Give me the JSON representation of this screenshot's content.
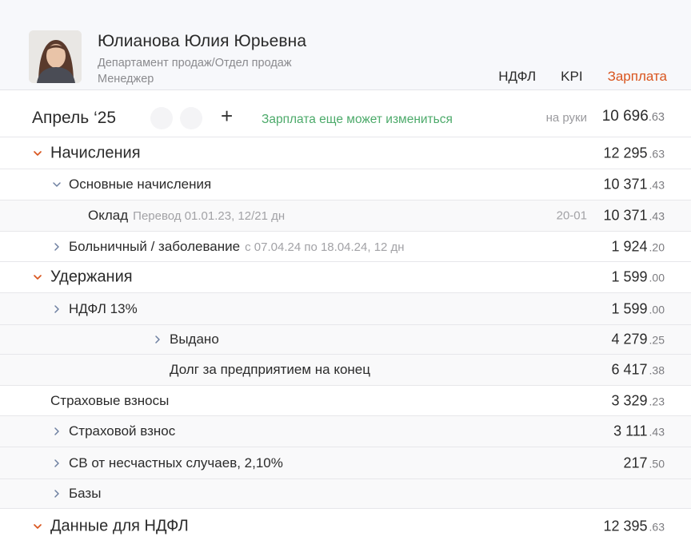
{
  "employee": {
    "name": "Юлианова Юлия Юрьевна",
    "department": "Департамент продаж/Отдел продаж",
    "role": "Менеджер"
  },
  "tabs": [
    "НДФЛ",
    "KPI",
    "Зарплата"
  ],
  "active_tab": "Зарплата",
  "period": {
    "month": "Апрель ‘25",
    "add_icon": "+",
    "warning": "Зарплата еще может измениться",
    "onhand_label": "на руки",
    "onhand_int": "10 696",
    "onhand_kop": ".63"
  },
  "rows": [
    {
      "label": "Начисления",
      "int": "12 295",
      "kop": ".63"
    },
    {
      "label": "Основные начисления",
      "int": "10 371",
      "kop": ".43"
    },
    {
      "label": "Оклад",
      "sub": "Перевод 01.01.23, 12/21 дн",
      "code": "20-01",
      "int": "10 371",
      "kop": ".43"
    },
    {
      "label": "Больничный / заболевание",
      "sub": "с 07.04.24 по 18.04.24, 12 дн",
      "int": "1 924",
      "kop": ".20"
    },
    {
      "label": "Удержания",
      "int": "1 599",
      "kop": ".00"
    },
    {
      "label": "НДФЛ 13%",
      "int": "1 599",
      "kop": ".00"
    },
    {
      "label": "Выдано",
      "int": "4 279",
      "kop": ".25"
    },
    {
      "label": "Долг за предприятием на конец",
      "int": "6 417",
      "kop": ".38"
    },
    {
      "label": "Страховые взносы",
      "int": "3 329",
      "kop": ".23"
    },
    {
      "label": "Страховой взнос",
      "int": "3 111",
      "kop": ".43"
    },
    {
      "label": "СВ от несчастных случаев, 2,10%",
      "int": "217",
      "kop": ".50"
    },
    {
      "label": "Базы"
    },
    {
      "label": "Данные для НДФЛ",
      "int": "12 395",
      "kop": ".63"
    }
  ],
  "colors": {
    "accent": "#d9551e",
    "positive": "#4caa6a",
    "muted": "#9a9a9e"
  }
}
